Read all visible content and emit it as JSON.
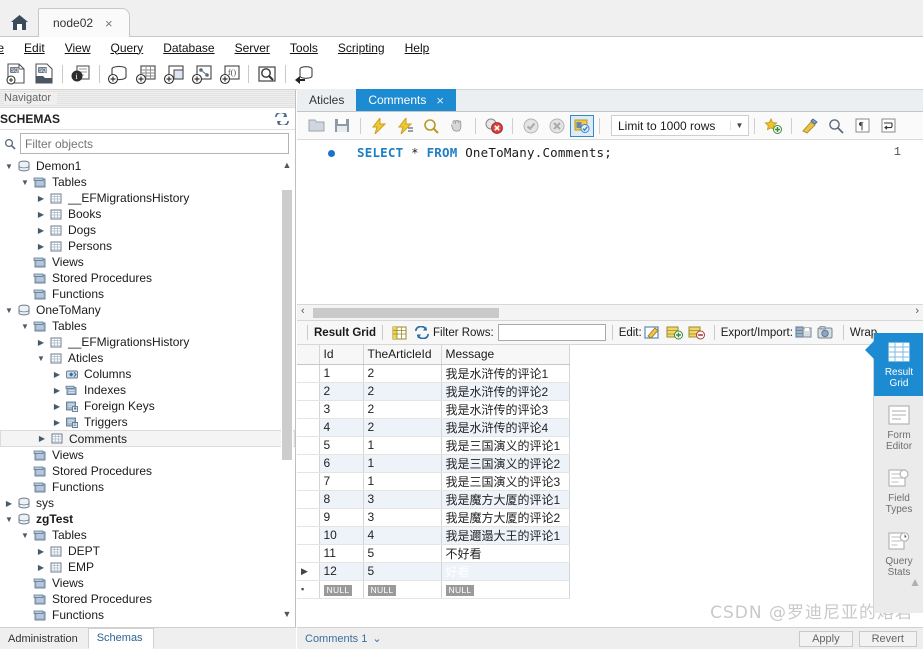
{
  "window": {
    "home_icon": "home-icon",
    "tab_label": "node02",
    "tab_close": "×"
  },
  "menubar": {
    "items": [
      "ile",
      "Edit",
      "View",
      "Query",
      "Database",
      "Server",
      "Tools",
      "Scripting",
      "Help"
    ]
  },
  "main_toolbar": {
    "icons": [
      "new-sql-tab-icon",
      "open-sql-script-icon",
      "connection-info-icon",
      "create-schema-icon",
      "create-table-icon",
      "create-view-icon",
      "create-procedure-icon",
      "create-function-icon",
      "search-data-icon",
      "reconnect-server-icon"
    ]
  },
  "navigator": {
    "caption": "Navigator",
    "section_title": "SCHEMAS",
    "refresh_icon": "refresh-icon",
    "search_icon": "search-icon",
    "filter_placeholder": "Filter objects",
    "filter_value": "",
    "tree": [
      {
        "label": "Demon1",
        "icon": "schema-icon",
        "indent": 0,
        "arrow": "down",
        "bold": false
      },
      {
        "label": "Tables",
        "icon": "folder-icon",
        "indent": 1,
        "arrow": "down",
        "bold": false
      },
      {
        "label": "__EFMigrationsHistory",
        "icon": "table-icon",
        "indent": 2,
        "arrow": "right",
        "bold": false
      },
      {
        "label": "Books",
        "icon": "table-icon",
        "indent": 2,
        "arrow": "right",
        "bold": false
      },
      {
        "label": "Dogs",
        "icon": "table-icon",
        "indent": 2,
        "arrow": "right",
        "bold": false
      },
      {
        "label": "Persons",
        "icon": "table-icon",
        "indent": 2,
        "arrow": "right",
        "bold": false
      },
      {
        "label": "Views",
        "icon": "folder-icon",
        "indent": 1,
        "arrow": "none",
        "bold": false
      },
      {
        "label": "Stored Procedures",
        "icon": "folder-icon",
        "indent": 1,
        "arrow": "none",
        "bold": false
      },
      {
        "label": "Functions",
        "icon": "folder-icon",
        "indent": 1,
        "arrow": "none",
        "bold": false
      },
      {
        "label": "OneToMany",
        "icon": "schema-icon",
        "indent": 0,
        "arrow": "down",
        "bold": false
      },
      {
        "label": "Tables",
        "icon": "folder-icon",
        "indent": 1,
        "arrow": "down",
        "bold": false
      },
      {
        "label": "__EFMigrationsHistory",
        "icon": "table-icon",
        "indent": 2,
        "arrow": "right",
        "bold": false
      },
      {
        "label": "Aticles",
        "icon": "table-icon",
        "indent": 2,
        "arrow": "down",
        "bold": false
      },
      {
        "label": "Columns",
        "icon": "columns-icon",
        "indent": 3,
        "arrow": "right",
        "bold": false
      },
      {
        "label": "Indexes",
        "icon": "indexes-icon",
        "indent": 3,
        "arrow": "right",
        "bold": false
      },
      {
        "label": "Foreign Keys",
        "icon": "foreignkey-icon",
        "indent": 3,
        "arrow": "right",
        "bold": false
      },
      {
        "label": "Triggers",
        "icon": "trigger-icon",
        "indent": 3,
        "arrow": "right",
        "bold": false
      },
      {
        "label": "Comments",
        "icon": "table-icon",
        "indent": 2,
        "arrow": "right",
        "bold": false,
        "selected": true
      },
      {
        "label": "Views",
        "icon": "folder-icon",
        "indent": 1,
        "arrow": "none",
        "bold": false
      },
      {
        "label": "Stored Procedures",
        "icon": "folder-icon",
        "indent": 1,
        "arrow": "none",
        "bold": false
      },
      {
        "label": "Functions",
        "icon": "folder-icon",
        "indent": 1,
        "arrow": "none",
        "bold": false
      },
      {
        "label": "sys",
        "icon": "schema-icon",
        "indent": 0,
        "arrow": "right",
        "bold": false
      },
      {
        "label": "zgTest",
        "icon": "schema-icon",
        "indent": 0,
        "arrow": "down",
        "bold": true
      },
      {
        "label": "Tables",
        "icon": "folder-icon",
        "indent": 1,
        "arrow": "down",
        "bold": false
      },
      {
        "label": "DEPT",
        "icon": "table-icon",
        "indent": 2,
        "arrow": "right",
        "bold": false
      },
      {
        "label": "EMP",
        "icon": "table-icon",
        "indent": 2,
        "arrow": "right",
        "bold": false
      },
      {
        "label": "Views",
        "icon": "folder-icon",
        "indent": 1,
        "arrow": "none",
        "bold": false
      },
      {
        "label": "Stored Procedures",
        "icon": "folder-icon",
        "indent": 1,
        "arrow": "none",
        "bold": false
      },
      {
        "label": "Functions",
        "icon": "folder-icon",
        "indent": 1,
        "arrow": "none",
        "bold": false
      }
    ],
    "bottom_tabs": [
      {
        "label": "Administration",
        "active": false
      },
      {
        "label": "Schemas",
        "active": true
      }
    ]
  },
  "editor": {
    "tabs": [
      {
        "label": "Aticles",
        "active": false,
        "closable": false
      },
      {
        "label": "Comments",
        "active": true,
        "closable": true,
        "close": "×"
      }
    ],
    "toolbar": {
      "icons": [
        "open-script-icon",
        "save-script-icon",
        "execute-icon",
        "execute-current-statement-icon",
        "explain-icon",
        "stop-icon",
        "toggle-stop-on-error-icon",
        "commit-icon",
        "rollback-icon",
        "autocommit-icon"
      ],
      "limit_label": "Limit to 1000 rows",
      "limit_caret": "▼",
      "right_icons": [
        "snippets-icon",
        "beautify-icon",
        "find-icon",
        "invisible-chars-icon",
        "wrap-lines-icon"
      ]
    },
    "code": {
      "line_number": "1",
      "keyword_select": "SELECT",
      "star": "*",
      "keyword_from": "FROM",
      "table_ref": "OneToMany.Comments;"
    },
    "hscroll": {
      "left_arrow": "‹",
      "right_arrow": "›"
    }
  },
  "result_toolbar": {
    "title": "Result Grid",
    "grid_view_icon": "grid-view-icon",
    "refresh_icon": "refresh-icon",
    "filter_label": "Filter Rows:",
    "filter_value": "",
    "edit_label": "Edit:",
    "edit_icons": [
      "edit-pencil-icon",
      "insert-row-icon",
      "delete-row-icon"
    ],
    "export_label": "Export/Import:",
    "export_icons": [
      "export-recordset-icon",
      "import-recordset-icon"
    ],
    "wrap_label": "Wrap"
  },
  "grid": {
    "columns": [
      "Id",
      "TheArticleId",
      "Message"
    ],
    "rows": [
      {
        "marker": "",
        "Id": "1",
        "TheArticleId": "2",
        "Message": "我是水浒传的评论1"
      },
      {
        "marker": "",
        "Id": "2",
        "TheArticleId": "2",
        "Message": "我是水浒传的评论2"
      },
      {
        "marker": "",
        "Id": "3",
        "TheArticleId": "2",
        "Message": "我是水浒传的评论3"
      },
      {
        "marker": "",
        "Id": "4",
        "TheArticleId": "2",
        "Message": "我是水浒传的评论4"
      },
      {
        "marker": "",
        "Id": "5",
        "TheArticleId": "1",
        "Message": "我是三国演义的评论1"
      },
      {
        "marker": "",
        "Id": "6",
        "TheArticleId": "1",
        "Message": "我是三国演义的评论2"
      },
      {
        "marker": "",
        "Id": "7",
        "TheArticleId": "1",
        "Message": "我是三国演义的评论3"
      },
      {
        "marker": "",
        "Id": "8",
        "TheArticleId": "3",
        "Message": "我是魔方大厦的评论1"
      },
      {
        "marker": "",
        "Id": "9",
        "TheArticleId": "3",
        "Message": "我是魔方大厦的评论2"
      },
      {
        "marker": "",
        "Id": "10",
        "TheArticleId": "4",
        "Message": "我是邇遢大王的评论1"
      },
      {
        "marker": "",
        "Id": "11",
        "TheArticleId": "5",
        "Message": "不好看"
      },
      {
        "marker": "▶",
        "Id": "12",
        "TheArticleId": "5",
        "Message": "好看",
        "selected_cell": "Message"
      }
    ],
    "new_row": {
      "marker": "▪",
      "Id": "NULL",
      "TheArticleId": "NULL",
      "Message": "NULL"
    }
  },
  "right_sidebar": {
    "items": [
      {
        "label_1": "Result",
        "label_2": "Grid",
        "icon": "result-grid-icon",
        "active": true
      },
      {
        "label_1": "Form",
        "label_2": "Editor",
        "icon": "form-editor-icon",
        "active": false
      },
      {
        "label_1": "Field",
        "label_2": "Types",
        "icon": "field-types-icon",
        "active": false
      },
      {
        "label_1": "Query",
        "label_2": "Stats",
        "icon": "query-stats-icon",
        "active": false
      }
    ]
  },
  "status_bar": {
    "result_tab": "Comments 1",
    "caret": "⌄",
    "apply_label": "Apply",
    "revert_label": "Revert"
  },
  "watermark": "CSDN @罗迪尼亚的熔岩",
  "colors": {
    "accent_blue": "#1d8bd1",
    "selection_blue": "#0f6fc6",
    "alt_row": "#eef3fa",
    "keyword": "#1d7fc4",
    "panel_grey": "#f0f0f0"
  }
}
